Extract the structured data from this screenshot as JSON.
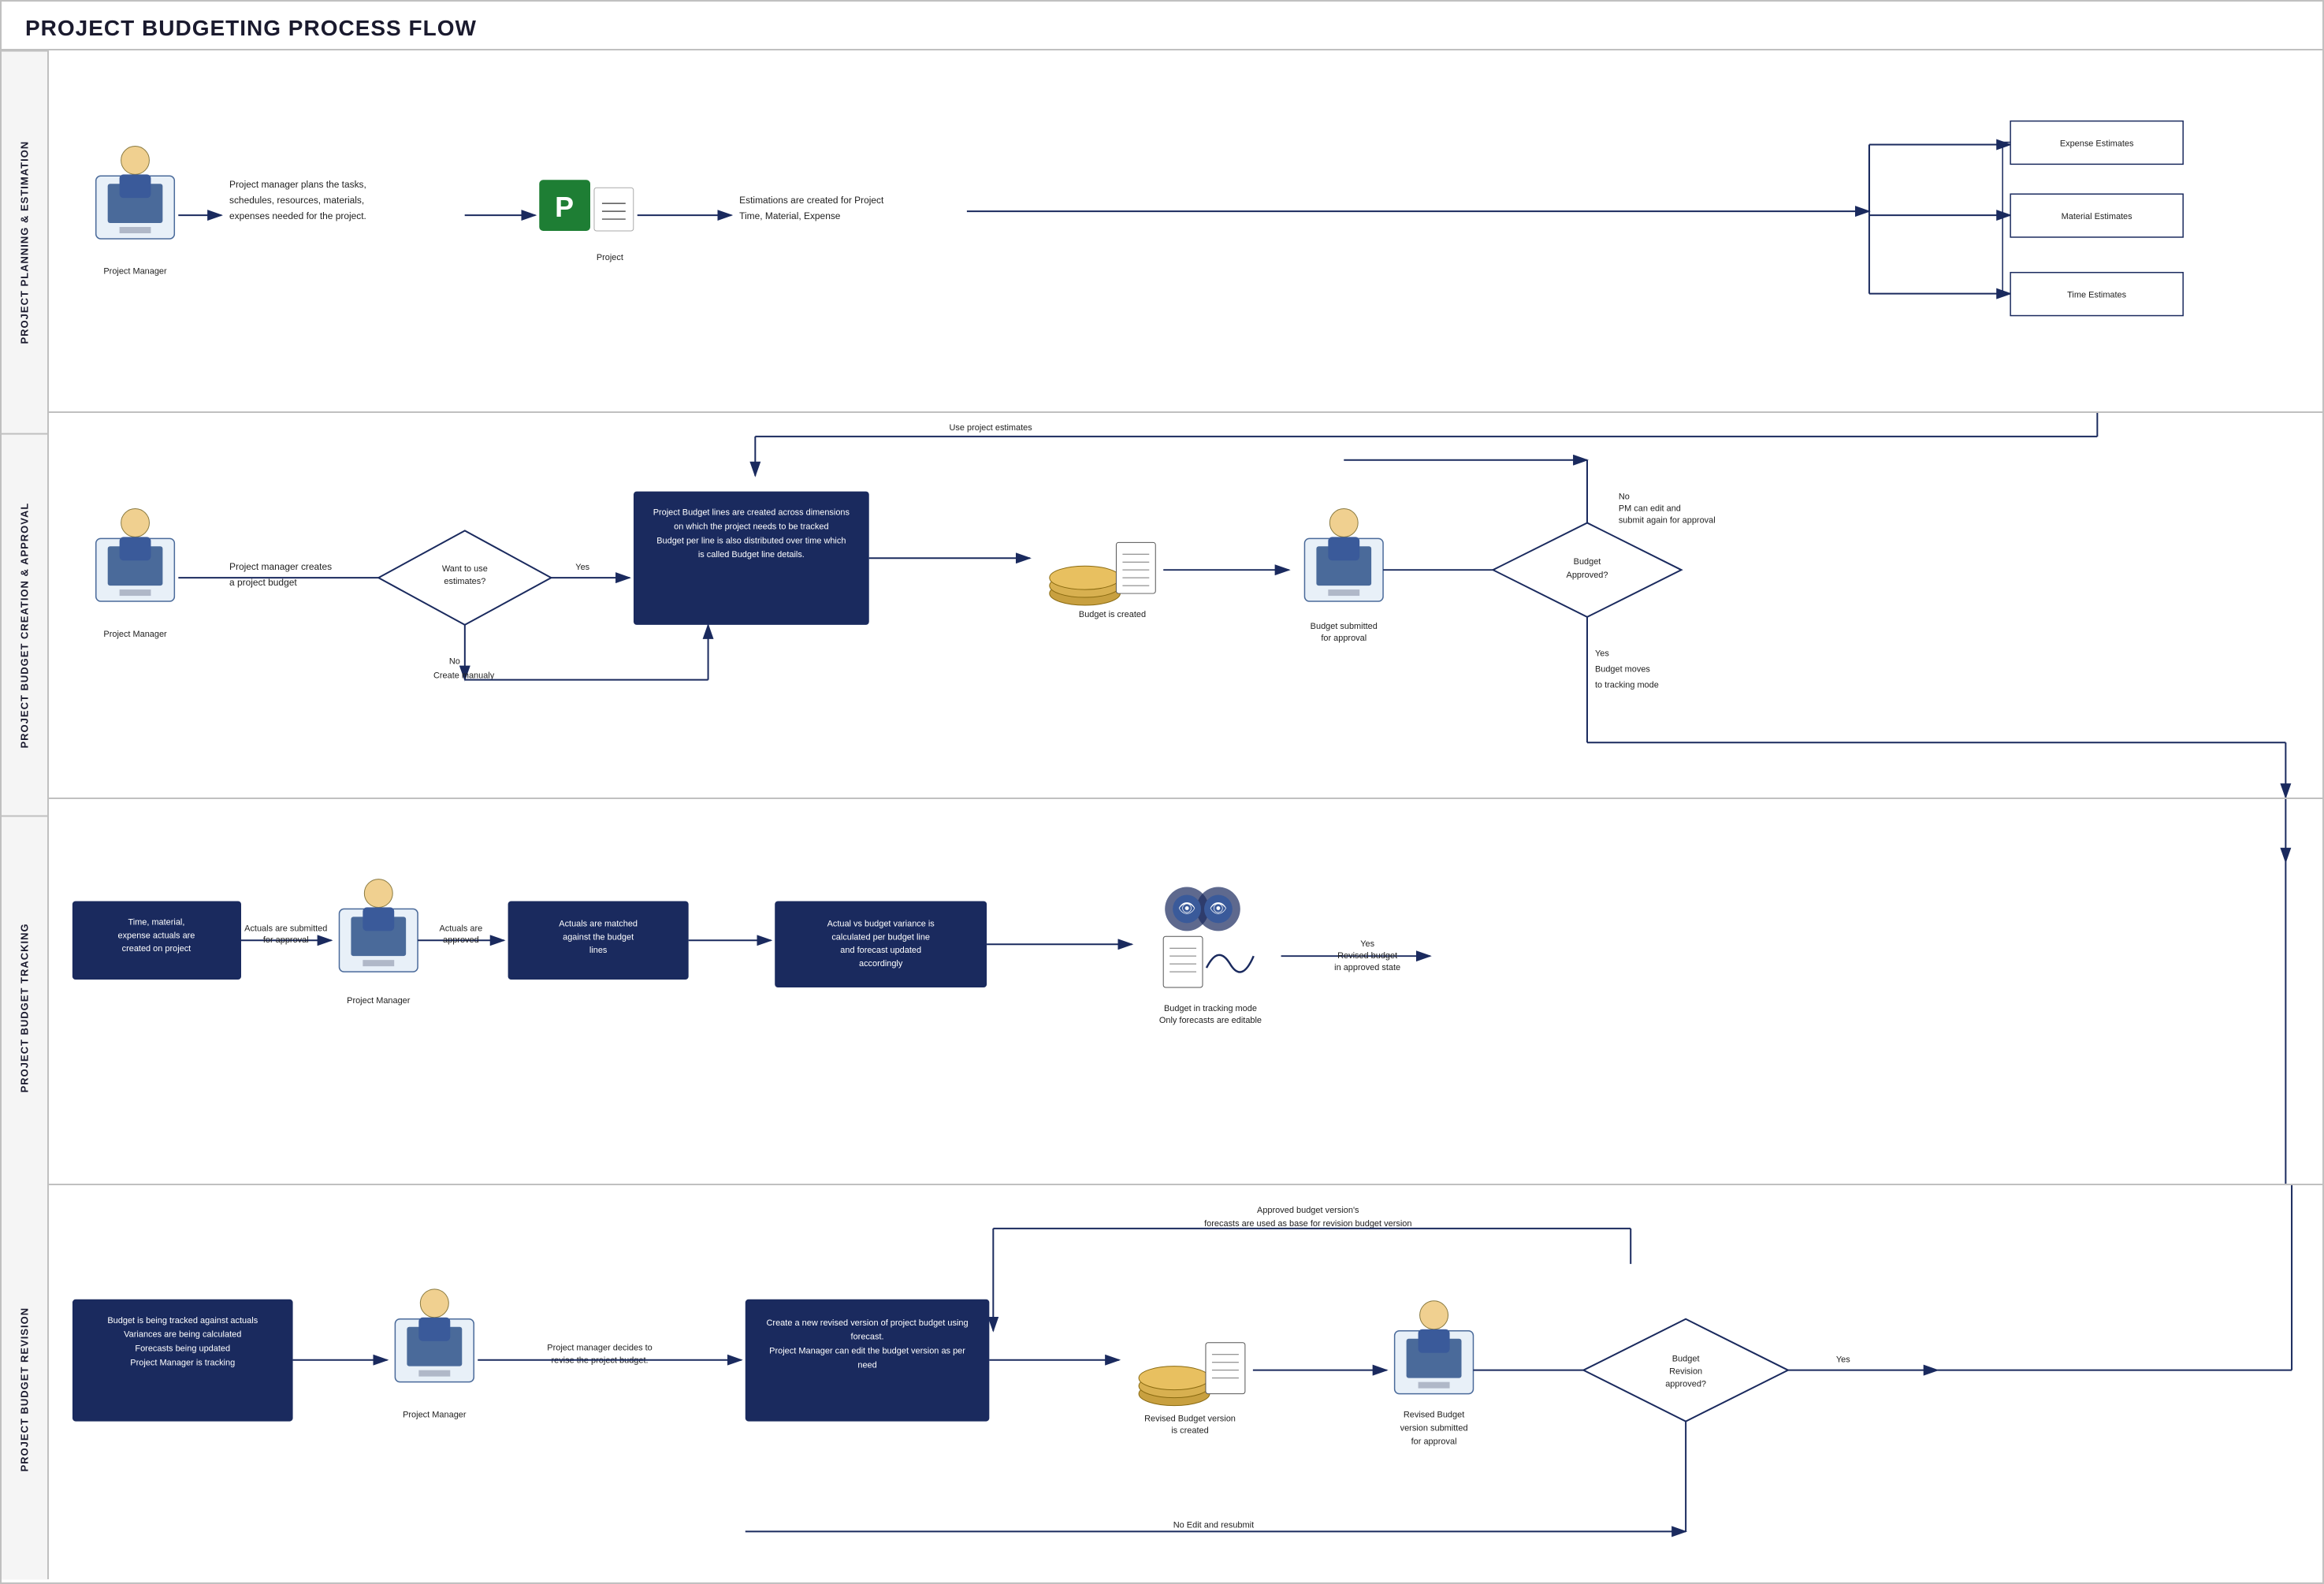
{
  "title": "PROJECT BUDGETING PROCESS FLOW",
  "swim_labels": [
    "PROJECT PLANNING & ESTIMATION",
    "PROJECT BUDGET CREATION & APPROVAL",
    "PROJECT BUDGET TRACKING",
    "PROJECT BUDGET REVISION"
  ],
  "lane1": {
    "actor": "Project Manager",
    "step1": "Project manager plans the tasks, schedules, resources, materials, expenses needed for the project.",
    "step2": "Estimations are created for Project Time, Material, Expense",
    "boxes": [
      "Expense Estimates",
      "Material Estimates",
      "Time Estimates"
    ]
  },
  "lane2": {
    "actor": "Project Manager",
    "step1": "Project manager creates a project budget",
    "diamond": "Want to use estimates?",
    "yes": "Yes",
    "no_top": "No",
    "no_bottom": "No\nCreate manualy",
    "use_estimates": "Use project estimates",
    "main_box": "Project Budget lines are created across dimensions on which the project needs to be tracked Budget per line is also distributed over time which is called Budget line details.",
    "budget_created": "Budget is created",
    "submitted": "Budget submitted for approval",
    "diamond2": "Budget Approved?",
    "no_edit": "No\nPM can edit and submit again for approval",
    "yes_move": "Yes\nBudget moves to tracking mode"
  },
  "lane3": {
    "box1": "Time, material, expense actuals are created on project",
    "step1": "Actuals are submitted for approval",
    "actor": "Project Manager",
    "step2": "Actuals are approved",
    "box2": "Actuals are matched against the budget lines",
    "box3": "Actual vs budget variance is calculated per budget line and forecast updated accordingly",
    "budget_tracking": "Budget in tracking mode\nOnly forecasts are editable",
    "yes_revised": "Yes\nRevised budget in approved state"
  },
  "lane4": {
    "box1": "Budget is being tracked against actuals\nVariances are being calculated\nForecasts being updated\nProject Manager is tracking",
    "actor": "Project Manager",
    "step1": "Project manager decides to revise the project budget.",
    "box2": "Create a new revised version of project budget using forecast.\nProject Manager can edit the budget version as per need",
    "revised_created": "Revised Budget version is created",
    "submitted": "Revised Budget version submitted for approval",
    "diamond": "Budget Revision approved?",
    "no_edit": "No Edit and resubmit",
    "forecasts_note": "Approved budget version's forecasts are used as base for revision budget version"
  }
}
